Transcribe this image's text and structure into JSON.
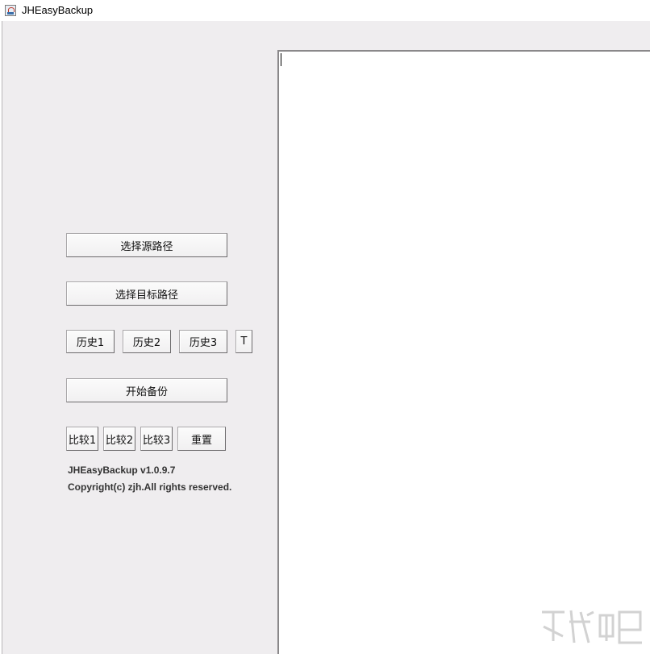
{
  "window": {
    "title": "JHEasyBackup",
    "icon": "java-cup-icon"
  },
  "controls": {
    "select_source_label": "选择源路径",
    "select_target_label": "选择目标路径",
    "history_labels": [
      "历史1",
      "历史2",
      "历史3"
    ],
    "t_label": "T",
    "start_backup_label": "开始备份",
    "compare_labels": [
      "比较1",
      "比较2",
      "比较3"
    ],
    "reset_label": "重置"
  },
  "info": {
    "version": "JHEasyBackup v1.0.9.7",
    "copyright": "Copyright(c) zjh.All rights reserved."
  },
  "log": {
    "text": ""
  },
  "colors": {
    "panel_bg": "#efedef",
    "text_area_bg": "#ffffff",
    "button_border": "#6d6b6d"
  }
}
